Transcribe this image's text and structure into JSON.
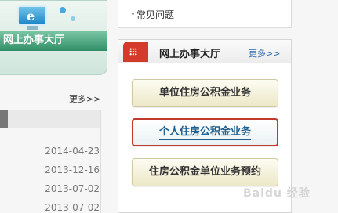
{
  "banner": {
    "title": "网上办事大厅",
    "icon": "ie-monitor-icon"
  },
  "news": {
    "more_label": "更多>>",
    "dates": [
      "2014-04-23",
      "2013-12-16",
      "2013-07-02",
      "2013-07-02"
    ]
  },
  "faq": {
    "item": "常见问题"
  },
  "hall": {
    "title": "网上办事大厅",
    "more_label": "更多>>",
    "buttons": [
      "单位住房公积金业务",
      "个人住房公积金业务",
      "住房公积金单位业务预约"
    ],
    "highlight_color": "#c0392b"
  },
  "watermark": "Baidu 经验"
}
